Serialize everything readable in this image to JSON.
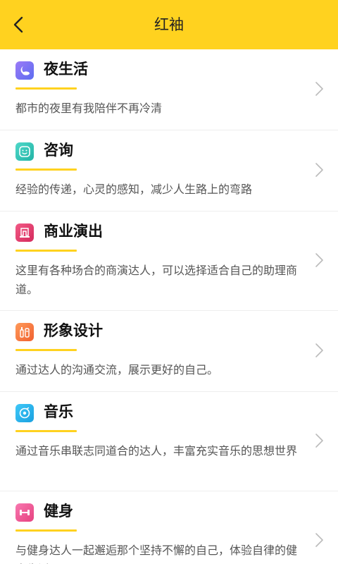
{
  "header": {
    "title": "红袖",
    "bg_color": "#FFD21F",
    "back_icon": "chevron-left-icon"
  },
  "items": [
    {
      "name": "夜生活",
      "desc": "都市的夜里有我陪伴不再冷清",
      "icon": "moon-cloud-icon",
      "icon_color": "#7B6CF6"
    },
    {
      "name": "咨询",
      "desc": "经验的传递，心灵的感知，减少人生路上的弯路",
      "icon": "smiley-icon",
      "icon_color": "#2EC4B6"
    },
    {
      "name": "商业演出",
      "desc": "这里有各种场合的商演达人，可以选择适合自己的助理商道。",
      "icon": "stage-icon",
      "icon_color": "#E8366D"
    },
    {
      "name": "形象设计",
      "desc": "通过达人的沟通交流，展示更好的自己。",
      "icon": "cosmetics-icon",
      "icon_color": "#F47A3F"
    },
    {
      "name": "音乐",
      "desc": "通过音乐串联志同道合的达人，丰富充实音乐的思想世界",
      "icon": "music-disc-icon",
      "icon_color": "#1FB3F0"
    },
    {
      "name": "健身",
      "desc": "与健身达人一起邂逅那个坚持不懈的自己，体验自律的健身生活",
      "icon": "dumbbell-icon",
      "icon_color": "#F0569A"
    }
  ]
}
